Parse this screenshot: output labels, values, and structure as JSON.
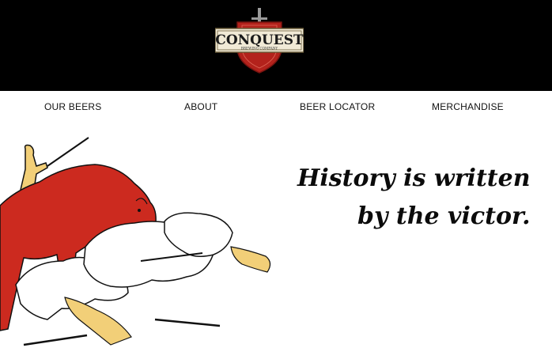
{
  "brand": {
    "name": "CONQUEST",
    "sub": "BREWING COMPANY"
  },
  "nav": {
    "items": [
      {
        "label": "OUR BEERS"
      },
      {
        "label": "ABOUT"
      },
      {
        "label": "BEER LOCATOR"
      },
      {
        "label": "MERCHANDISE"
      }
    ]
  },
  "hero": {
    "line1": "History is written",
    "line2": "by the victor."
  },
  "colors": {
    "header_bg": "#000000",
    "shield_red": "#b3221c",
    "bull_red": "#cc2a1f",
    "rider_yellow": "#f2cf78"
  }
}
